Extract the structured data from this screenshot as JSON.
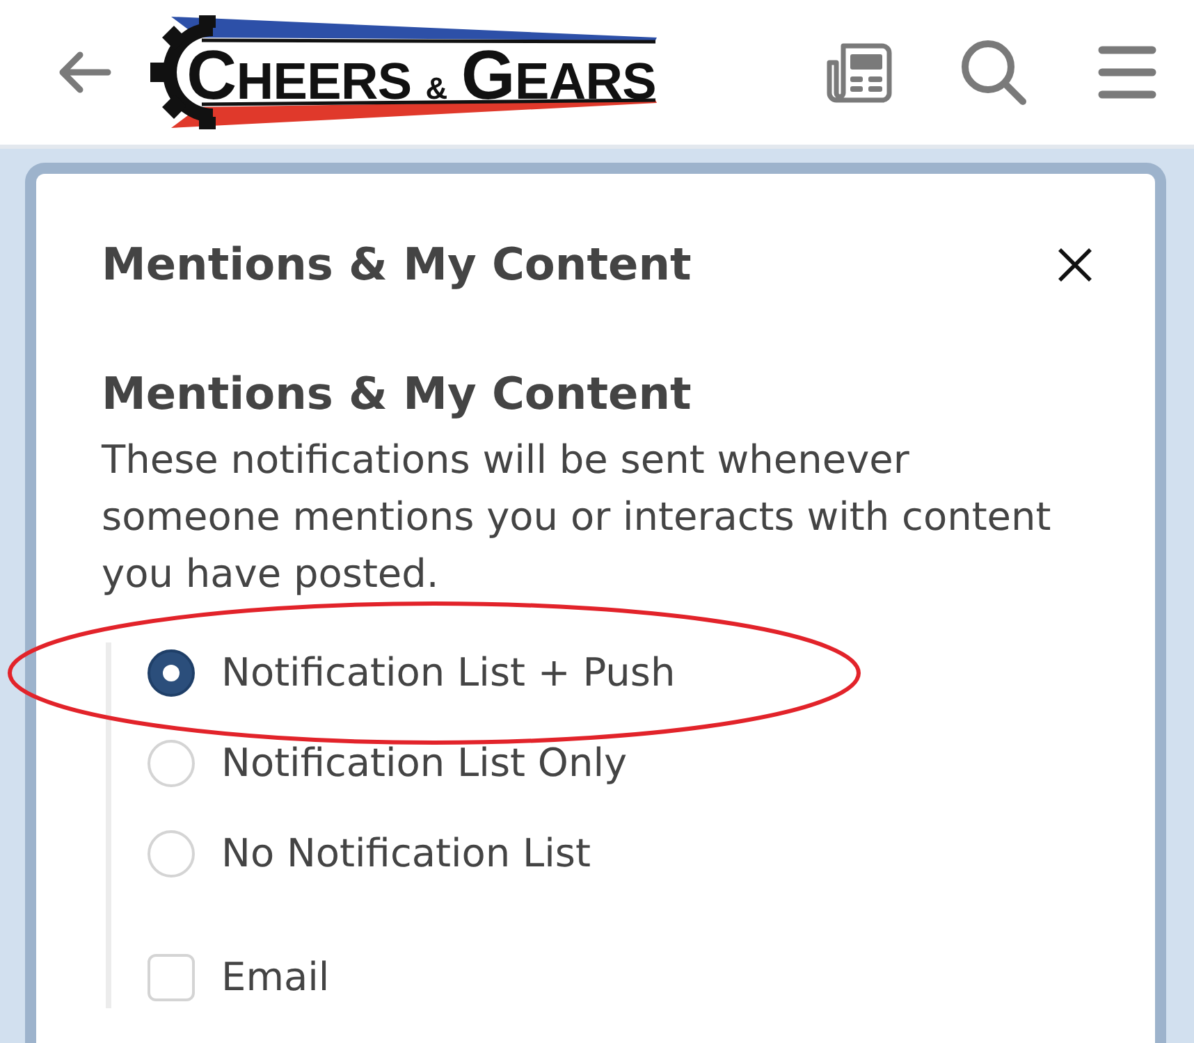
{
  "header": {
    "logo": "CHEERS & GEARS"
  },
  "modal": {
    "title": "Mentions & My Content",
    "section": {
      "heading": "Mentions & My Content",
      "description": "These notifications will be sent whenever someone mentions you or interacts with content you have posted."
    },
    "options": [
      {
        "kind": "radio",
        "label": "Notification List + Push",
        "selected": true,
        "highlighted": true
      },
      {
        "kind": "radio",
        "label": "Notification List Only",
        "selected": false,
        "highlighted": false
      },
      {
        "kind": "radio",
        "label": "No Notification List",
        "selected": false,
        "highlighted": false
      },
      {
        "kind": "checkbox",
        "label": "Email",
        "checked": false,
        "highlighted": false
      }
    ]
  }
}
